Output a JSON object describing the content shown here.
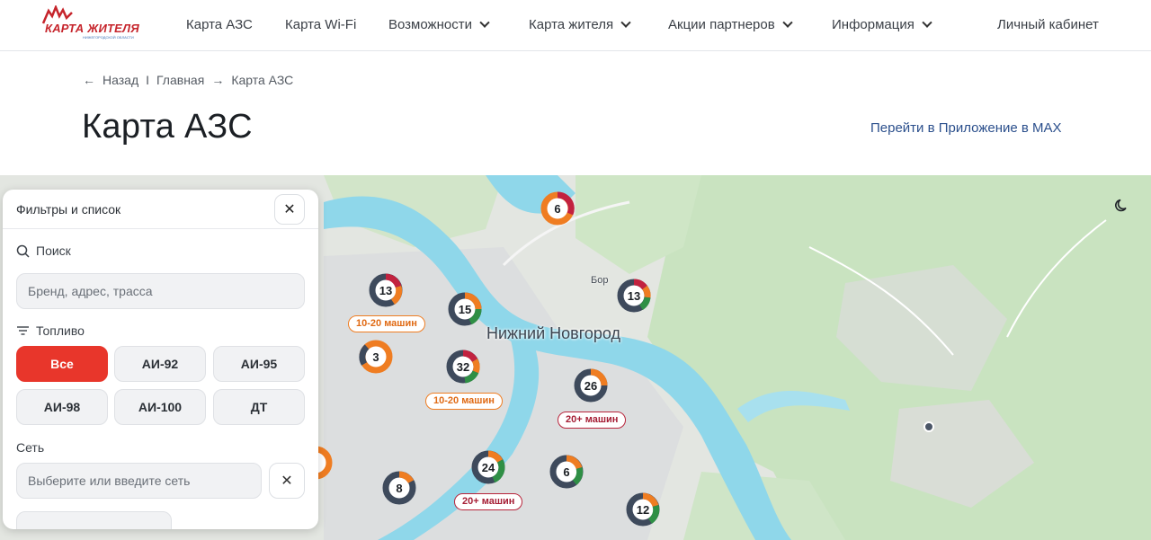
{
  "header": {
    "logo_text": "КАРТА ЖИТЕЛЯ",
    "logo_subtext": "НИЖЕГОРОДСКОЙ ОБЛАСТИ",
    "nav": [
      {
        "label": "Карта АЗС",
        "dropdown": false
      },
      {
        "label": "Карта Wi-Fi",
        "dropdown": false
      },
      {
        "label": "Возможности",
        "dropdown": true
      },
      {
        "label": "Карта жителя",
        "dropdown": true
      },
      {
        "label": "Акции партнеров",
        "dropdown": true
      },
      {
        "label": "Информация",
        "dropdown": true
      }
    ],
    "account": "Личный кабинет"
  },
  "breadcrumb": {
    "back": "Назад",
    "separator": "I",
    "home": "Главная",
    "current": "Карта АЗС"
  },
  "page": {
    "title": "Карта АЗС",
    "app_link": "Перейти в Приложение в MAX"
  },
  "map": {
    "city_label": "Нижний Новгород",
    "town_label": "Бор",
    "clusters": [
      {
        "count": "6"
      },
      {
        "count": "13"
      },
      {
        "count": "15"
      },
      {
        "count": "13"
      },
      {
        "count": "3"
      },
      {
        "count": "32"
      },
      {
        "count": "26"
      },
      {
        "count": "24"
      },
      {
        "count": "6"
      },
      {
        "count": "8"
      },
      {
        "count": "12"
      }
    ],
    "badges": [
      {
        "label": "10-20 машин",
        "level": "orange"
      },
      {
        "label": "10-20 машин",
        "level": "orange"
      },
      {
        "label": "20+ машин",
        "level": "red"
      },
      {
        "label": "20+ машин",
        "level": "red"
      }
    ],
    "colors": {
      "orange": "#ef7d22",
      "green": "#2f8f45",
      "red": "#c2223f",
      "dark": "#3e4a5c",
      "water": "#8fd7ea"
    }
  },
  "panel": {
    "title": "Фильтры и список",
    "search_label": "Поиск",
    "search_placeholder": "Бренд, адрес, трасса",
    "fuel_label": "Топливо",
    "fuel_chips": [
      "Все",
      "АИ-92",
      "АИ-95",
      "АИ-98",
      "АИ-100",
      "ДТ"
    ],
    "network_label": "Сеть",
    "network_placeholder": "Выберите или введите сеть"
  }
}
